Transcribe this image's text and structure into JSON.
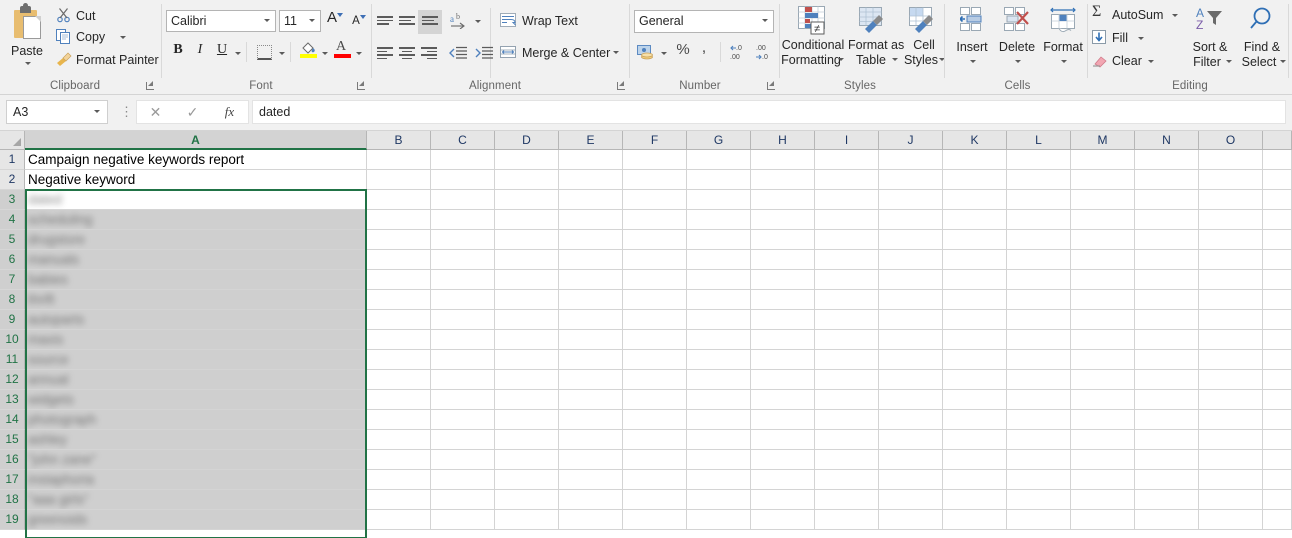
{
  "app": "Microsoft Excel",
  "ribbon": {
    "groups": [
      {
        "name": "Clipboard",
        "label": "Clipboard"
      },
      {
        "name": "Font",
        "label": "Font"
      },
      {
        "name": "Alignment",
        "label": "Alignment"
      },
      {
        "name": "Number",
        "label": "Number"
      },
      {
        "name": "Styles",
        "label": "Styles"
      },
      {
        "name": "Cells",
        "label": "Cells"
      },
      {
        "name": "Editing",
        "label": "Editing"
      }
    ],
    "clipboard": {
      "paste": "Paste",
      "cut": "Cut",
      "copy": "Copy",
      "format_painter": "Format Painter"
    },
    "font": {
      "font_name": "Calibri",
      "font_size": "11",
      "grow_font": "A",
      "shrink_font": "A",
      "bold": "B",
      "italic": "I",
      "underline": "U"
    },
    "alignment": {
      "wrap_text": "Wrap Text",
      "merge_center": "Merge & Center"
    },
    "number": {
      "format": "General",
      "percent": "%",
      "comma": ",",
      "decrease_decimal": ".00",
      "increase_decimal": ".00"
    },
    "styles": {
      "conditional_formatting_line1": "Conditional",
      "conditional_formatting_line2": "Formatting",
      "format_as_table_line1": "Format as",
      "format_as_table_line2": "Table",
      "cell_styles_line1": "Cell",
      "cell_styles_line2": "Styles"
    },
    "cells": {
      "insert": "Insert",
      "delete": "Delete",
      "format": "Format"
    },
    "editing": {
      "autosum": "AutoSum",
      "fill": "Fill",
      "clear": "Clear",
      "sort_filter_line1": "Sort &",
      "sort_filter_line2": "Filter",
      "find_select_line1": "Find &",
      "find_select_line2": "Select"
    }
  },
  "formula_bar": {
    "name_box": "A3",
    "cancel_icon": "✕",
    "confirm_icon": "✓",
    "function_icon": "fx",
    "value": "dated",
    "placeholder": ""
  },
  "grid": {
    "columns": [
      "A",
      "B",
      "C",
      "D",
      "E",
      "F",
      "G",
      "H",
      "I",
      "J",
      "K",
      "L",
      "M",
      "N",
      "O"
    ],
    "selected_column": "A",
    "rows": [
      {
        "num": "1",
        "value": "Campaign negative keywords report",
        "redacted": false,
        "selected": false,
        "active": false
      },
      {
        "num": "2",
        "value": "Negative keyword",
        "redacted": false,
        "selected": false,
        "active": false
      },
      {
        "num": "3",
        "value": "dated",
        "redacted": true,
        "selected": true,
        "active": true
      },
      {
        "num": "4",
        "value": "scheduling",
        "redacted": true,
        "selected": true,
        "active": false
      },
      {
        "num": "5",
        "value": "drugstore",
        "redacted": true,
        "selected": true,
        "active": false
      },
      {
        "num": "6",
        "value": "manuals",
        "redacted": true,
        "selected": true,
        "active": false
      },
      {
        "num": "7",
        "value": "babies",
        "redacted": true,
        "selected": true,
        "active": false
      },
      {
        "num": "8",
        "value": "thrift",
        "redacted": true,
        "selected": true,
        "active": false
      },
      {
        "num": "9",
        "value": "autoparts",
        "redacted": true,
        "selected": true,
        "active": false
      },
      {
        "num": "10",
        "value": "maxis",
        "redacted": true,
        "selected": true,
        "active": false
      },
      {
        "num": "11",
        "value": "source",
        "redacted": true,
        "selected": true,
        "active": false
      },
      {
        "num": "12",
        "value": "annual",
        "redacted": true,
        "selected": true,
        "active": false
      },
      {
        "num": "13",
        "value": "widgets",
        "redacted": true,
        "selected": true,
        "active": false
      },
      {
        "num": "14",
        "value": "photograph",
        "redacted": true,
        "selected": true,
        "active": false
      },
      {
        "num": "15",
        "value": "ashley",
        "redacted": true,
        "selected": true,
        "active": false
      },
      {
        "num": "16",
        "value": "\"john zane\"",
        "redacted": true,
        "selected": true,
        "active": false
      },
      {
        "num": "17",
        "value": "instaphoria",
        "redacted": true,
        "selected": true,
        "active": false
      },
      {
        "num": "18",
        "value": "\"aaa girls\"",
        "redacted": true,
        "selected": true,
        "active": false
      },
      {
        "num": "19",
        "value": "greenoids",
        "redacted": true,
        "selected": true,
        "active": false
      }
    ]
  },
  "colors": {
    "excel_green": "#217346",
    "ribbon_bg": "#f1f1f1",
    "header_bg": "#e6e6e6",
    "selection_fill": "#cfcfcf",
    "gridline": "#d4d4d4",
    "header_text": "#1f3864",
    "fill_color": "#ffff00",
    "font_color": "#ff0000"
  }
}
